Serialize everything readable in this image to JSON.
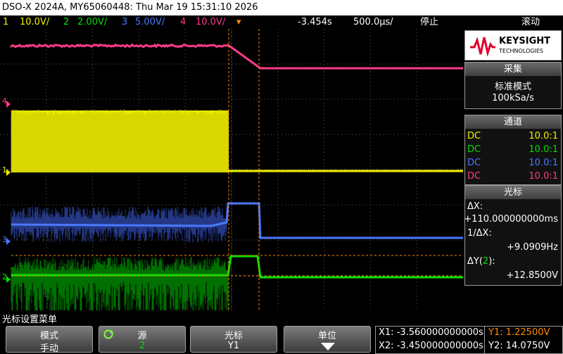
{
  "title_bar": "DSO-X 2024A, MY65060448: Thu Mar 19 15:31:10 2026",
  "status_bar": {
    "ch1": {
      "num": "1",
      "scale": "10.0V/",
      "color": "#f0f000"
    },
    "ch2": {
      "num": "2",
      "scale": "2.00V/",
      "color": "#00e000"
    },
    "ch3": {
      "num": "3",
      "scale": "5.00V/",
      "color": "#4a78ff"
    },
    "ch4": {
      "num": "4",
      "scale": "10.0V/",
      "color": "#ff3a8a"
    },
    "delay": "-3.454s",
    "timebase": "500.0μs/",
    "run_state": "停止",
    "mode": "滚动"
  },
  "channel_markers": {
    "ch4": "4",
    "ch1": "1",
    "ch3": "3",
    "ch2": "2"
  },
  "brand": {
    "name": "KEYSIGHT",
    "sub": "TECHNOLOGIES"
  },
  "acquisition": {
    "header": "采集",
    "mode": "标准模式",
    "rate": "100kSa/s"
  },
  "channels_panel": {
    "header": "通道",
    "rows": [
      {
        "coupling": "DC",
        "probe": "10.0:1",
        "color": "#f0f000"
      },
      {
        "coupling": "DC",
        "probe": "10.0:1",
        "color": "#00e000"
      },
      {
        "coupling": "DC",
        "probe": "10.0:1",
        "color": "#4a78ff"
      },
      {
        "coupling": "DC",
        "probe": "10.0:1",
        "color": "#ff3a8a"
      }
    ]
  },
  "cursors_panel": {
    "header": "光标",
    "dx_label": "ΔX:",
    "dx_value": "+110.000000000ms",
    "inv_dx_label": "1/ΔX:",
    "inv_dx_value": "+9.0909Hz",
    "dy_label": "ΔY(",
    "dy_channel": "2",
    "dy_label_end": "):",
    "dy_value": "+12.8500V"
  },
  "softkey_menu_title": "光标设置菜单",
  "softkeys": {
    "mode": {
      "label": "模式",
      "value": "手动"
    },
    "source": {
      "label": "源",
      "value": "2"
    },
    "cursor": {
      "label": "光标",
      "value": "Y1"
    },
    "units": {
      "label": "单位",
      "value": ""
    }
  },
  "cursor_readout": {
    "x1": "X1: -3.560000000000s",
    "x2": "X2: -3.450000000000s",
    "y1": "Y1: 1.22500V",
    "y2": "Y2: 14.0750V"
  },
  "colors": {
    "ch1": "#f0f000",
    "ch2": "#00e000",
    "ch3": "#4a78ff",
    "ch4": "#ff3a8a",
    "cursor_orange": "#ff8a00",
    "grid": "#5a5a5a"
  }
}
